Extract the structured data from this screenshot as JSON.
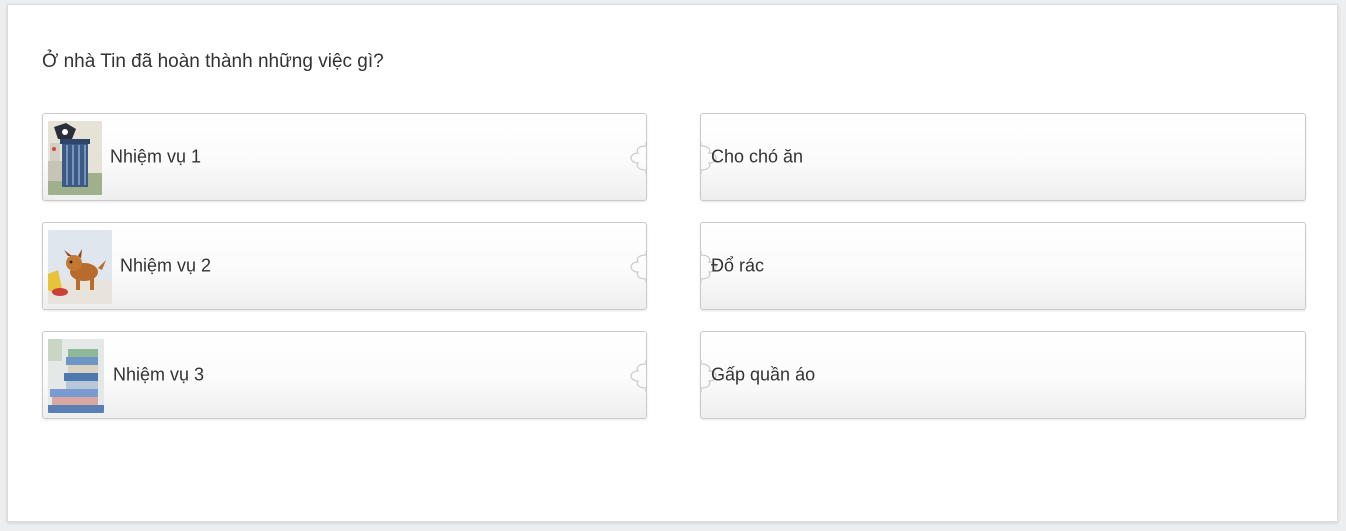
{
  "question": "Ở nhà Tin đã hoàn thành những việc gì?",
  "left_items": [
    {
      "label": "Nhiệm vụ 1",
      "image": "trash-bin-image"
    },
    {
      "label": "Nhiệm vụ 2",
      "image": "dog-eating-image"
    },
    {
      "label": "Nhiệm vụ 3",
      "image": "folded-clothes-image"
    }
  ],
  "right_items": [
    {
      "label": "Cho chó ăn"
    },
    {
      "label": "Đổ rác"
    },
    {
      "label": "Gấp quần áo"
    }
  ],
  "colors": {
    "page_background": "#eceef0",
    "card_background": "#ffffff",
    "piece_border": "#c9cbcd",
    "text": "#333333"
  }
}
